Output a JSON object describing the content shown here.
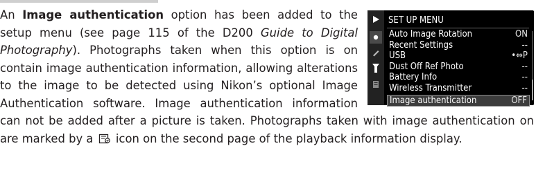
{
  "para": {
    "s1": "An ",
    "bold": "Image authentication",
    "s2": " option has been added to the setup menu (see page 115 of the D200 ",
    "italic": "Guide to Digital Photography",
    "s3": "). Photographs taken when this option is on contain image authentication information, allowing alterations to the image to be detected using Nikon’s optional Image Authentication software.  Image authentication information can not be added after a picture is taken.  Photographs taken with image authentication on are marked by a",
    "s4": "icon on the second page of the playback information display."
  },
  "menu": {
    "title": "SET UP MENU",
    "tab_icons": [
      "playback-icon",
      "shooting-icon",
      "custom-settings-icon",
      "setup-wrench-icon",
      "my-menu-icon"
    ],
    "items": [
      {
        "label": "Auto Image Rotation",
        "value": "ON"
      },
      {
        "label": "Recent Settings",
        "value": "--"
      },
      {
        "label": "USB",
        "value": "•⇔P"
      },
      {
        "label": "Dust Off Ref Photo",
        "value": "--"
      },
      {
        "label": "Battery Info",
        "value": "--"
      },
      {
        "label": "Wireless Transmitter",
        "value": "--"
      },
      {
        "label": "Image authentication",
        "value": "OFF"
      }
    ],
    "selected_index": 6
  }
}
